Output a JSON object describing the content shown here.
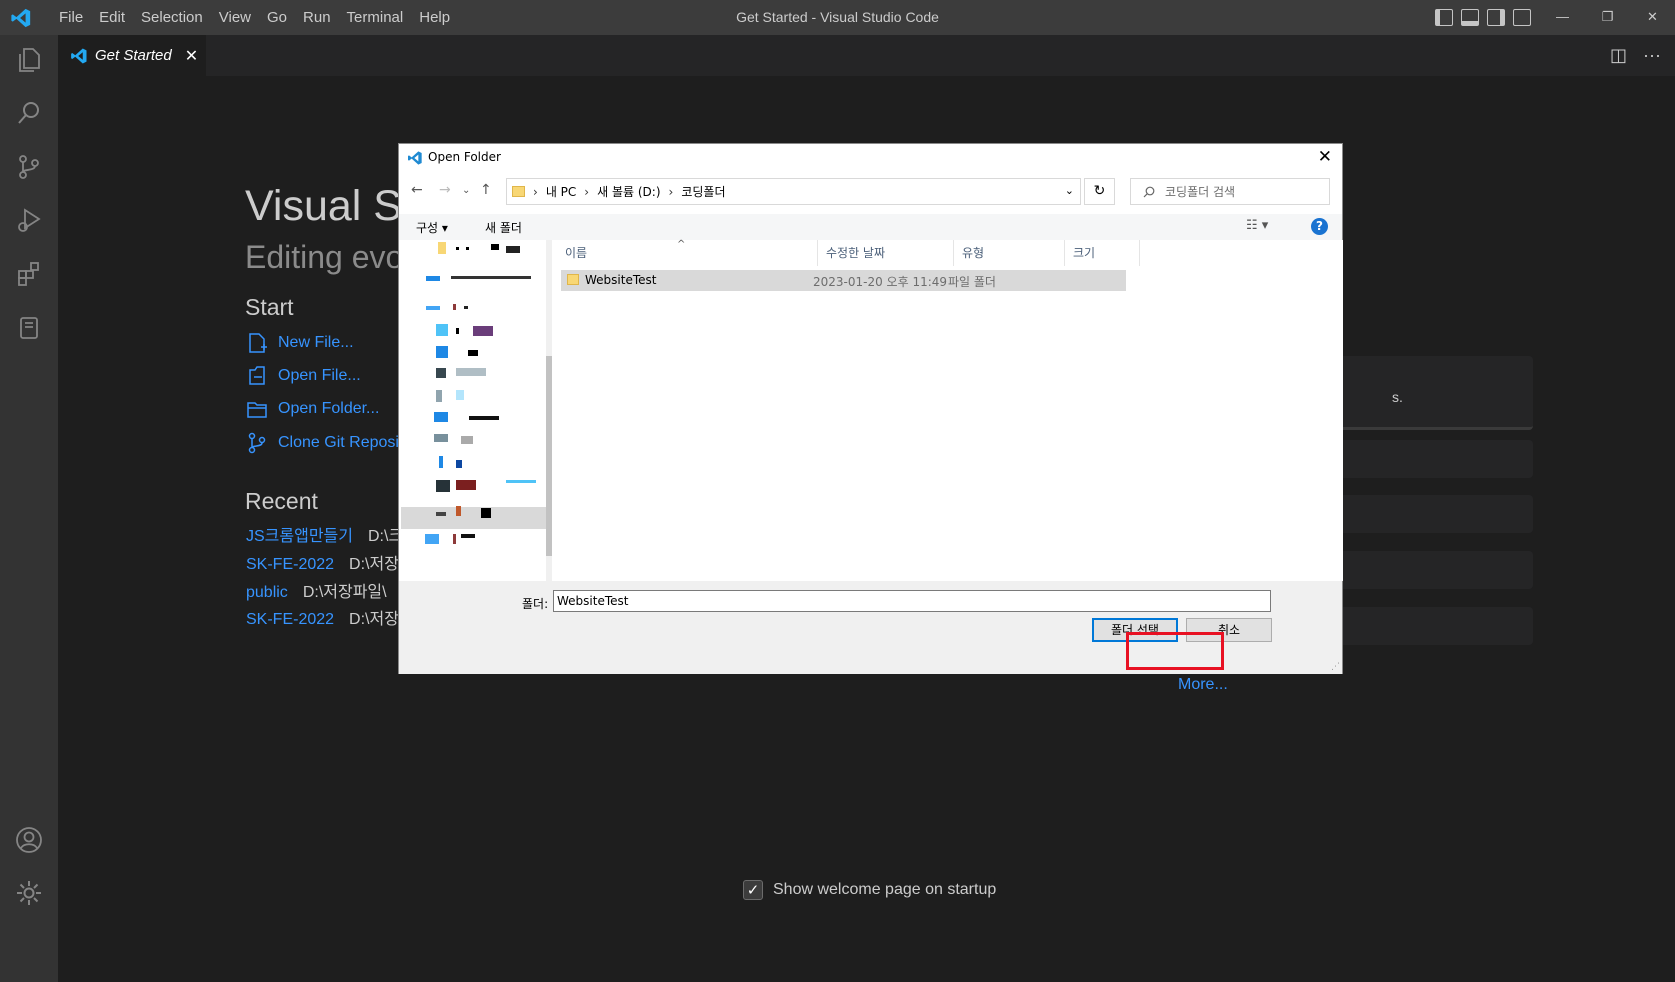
{
  "window": {
    "title": "Get Started - Visual Studio Code",
    "menu": [
      "File",
      "Edit",
      "Selection",
      "View",
      "Go",
      "Run",
      "Terminal",
      "Help"
    ]
  },
  "activity": [
    "explorer-icon",
    "search-icon",
    "source-control-icon",
    "run-debug-icon",
    "extensions-icon",
    "notebook-icon",
    "account-icon",
    "manage-gear-icon"
  ],
  "tab": {
    "label": "Get Started",
    "close": "✕"
  },
  "welcome": {
    "title": "Visual St",
    "subtitle": "Editing evo",
    "start_heading": "Start",
    "start_items": [
      "New File...",
      "Open File...",
      "Open Folder...",
      "Clone Git Reposit"
    ],
    "recent_heading": "Recent",
    "recent": [
      {
        "name": "JS크롬앱만들기",
        "path": "D:\\크"
      },
      {
        "name": "SK-FE-2022",
        "path": "D:\\저장"
      },
      {
        "name": "public",
        "path": "D:\\저장파일\\"
      },
      {
        "name": "SK-FE-2022",
        "path": "D:\\저장"
      }
    ],
    "walkthrough_fragment": "s.",
    "more": "More...",
    "show_on_startup": "Show welcome page on startup",
    "show_on_startup_checked": true
  },
  "dialog": {
    "title": "Open Folder",
    "address": [
      "내 PC",
      "새 볼륨 (D:)",
      "코딩폴더"
    ],
    "search_placeholder": "코딩폴더 검색",
    "organize": "구성 ▾",
    "new_folder": "새 폴더",
    "columns": [
      "이름",
      "수정한 날짜",
      "유형",
      "크기"
    ],
    "files": [
      {
        "name": "WebsiteTest",
        "modified": "2023-01-20 오후 11:49",
        "type": "파일 폴더",
        "size": ""
      }
    ],
    "folder_label": "폴더:",
    "folder_value": "WebsiteTest",
    "select_button": "폴더 선택",
    "cancel_button": "취소"
  }
}
